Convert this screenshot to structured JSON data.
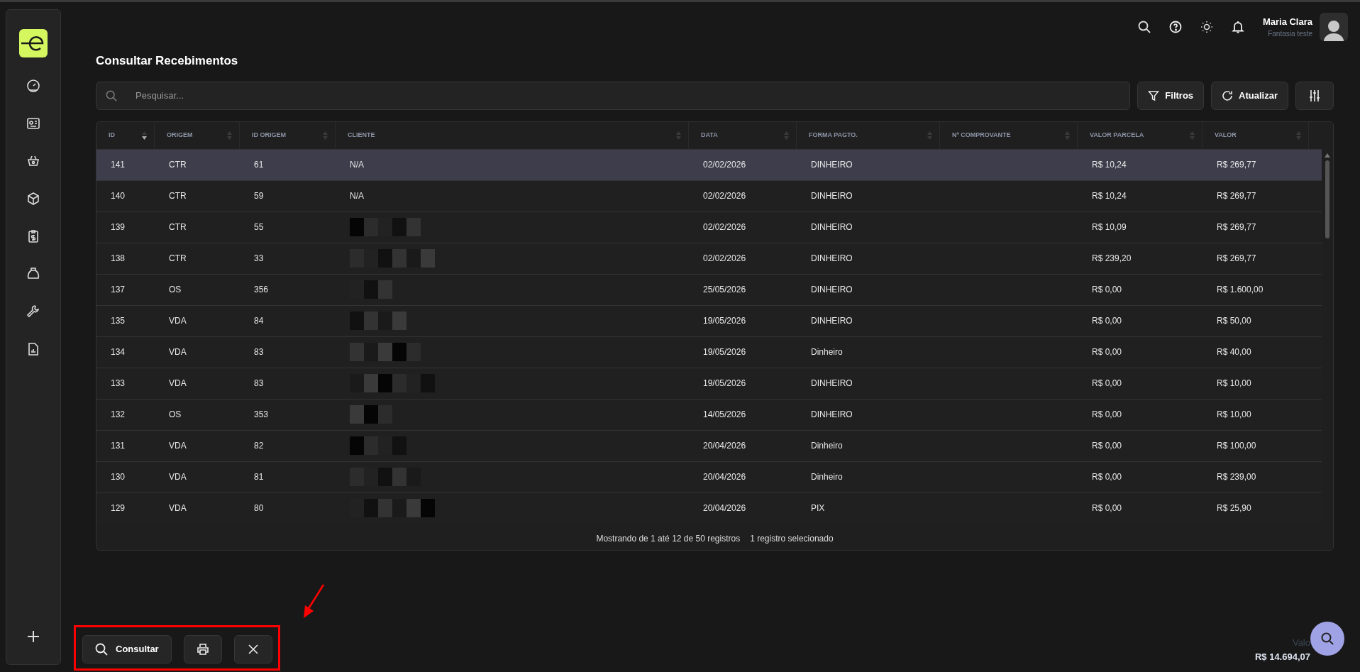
{
  "page_title": "Consultar Recebimentos",
  "user": {
    "name": "Maria Clara",
    "subtitle": "Fantasia teste"
  },
  "search": {
    "placeholder": "Pesquisar..."
  },
  "toolbar": [
    "Filtros",
    "Atualizar"
  ],
  "table": {
    "columns": [
      {
        "label": "ID",
        "sorted_desc": true
      },
      {
        "label": "ORIGEM",
        "sorted_desc": false
      },
      {
        "label": "ID ORIGEM",
        "sorted_desc": false
      },
      {
        "label": "CLIENTE",
        "sorted_desc": false
      },
      {
        "label": "DATA",
        "sorted_desc": false
      },
      {
        "label": "FORMA PAGTO.",
        "sorted_desc": false
      },
      {
        "label": "Nº COMPROVANTE",
        "sorted_desc": false
      },
      {
        "label": "VALOR PARCELA",
        "sorted_desc": false
      },
      {
        "label": "VALOR",
        "sorted_desc": false
      }
    ],
    "rows": [
      {
        "selected": true,
        "id": "141",
        "origem": "CTR",
        "id_origem": "61",
        "cliente": {
          "kind": "text",
          "text": "N/A"
        },
        "data": "02/02/2026",
        "forma": "DINHEIRO",
        "parcela": "R$ 10,24",
        "valor": "R$ 269,77"
      },
      {
        "selected": false,
        "id": "140",
        "origem": "CTR",
        "id_origem": "59",
        "cliente": {
          "kind": "text",
          "text": "N/A"
        },
        "data": "02/02/2026",
        "forma": "DINHEIRO",
        "parcela": "R$ 10,24",
        "valor": "R$ 269,77"
      },
      {
        "selected": false,
        "id": "139",
        "origem": "CTR",
        "id_origem": "55",
        "cliente": {
          "kind": "redacted"
        },
        "data": "02/02/2026",
        "forma": "DINHEIRO",
        "parcela": "R$ 10,09",
        "valor": "R$ 269,77"
      },
      {
        "selected": false,
        "id": "138",
        "origem": "CTR",
        "id_origem": "33",
        "cliente": {
          "kind": "redacted"
        },
        "data": "02/02/2026",
        "forma": "DINHEIRO",
        "parcela": "R$ 239,20",
        "valor": "R$ 269,77"
      },
      {
        "selected": false,
        "id": "137",
        "origem": "OS",
        "id_origem": "356",
        "cliente": {
          "kind": "redacted"
        },
        "data": "25/05/2026",
        "forma": "DINHEIRO",
        "parcela": "R$ 0,00",
        "valor": "R$ 1.600,00"
      },
      {
        "selected": false,
        "id": "135",
        "origem": "VDA",
        "id_origem": "84",
        "cliente": {
          "kind": "redacted"
        },
        "data": "19/05/2026",
        "forma": "DINHEIRO",
        "parcela": "R$ 0,00",
        "valor": "R$ 50,00"
      },
      {
        "selected": false,
        "id": "134",
        "origem": "VDA",
        "id_origem": "83",
        "cliente": {
          "kind": "redacted"
        },
        "data": "19/05/2026",
        "forma": "Dinheiro",
        "parcela": "R$ 0,00",
        "valor": "R$ 40,00"
      },
      {
        "selected": false,
        "id": "133",
        "origem": "VDA",
        "id_origem": "83",
        "cliente": {
          "kind": "redacted"
        },
        "data": "19/05/2026",
        "forma": "DINHEIRO",
        "parcela": "R$ 0,00",
        "valor": "R$ 10,00"
      },
      {
        "selected": false,
        "id": "132",
        "origem": "OS",
        "id_origem": "353",
        "cliente": {
          "kind": "redacted"
        },
        "data": "14/05/2026",
        "forma": "DINHEIRO",
        "parcela": "R$ 0,00",
        "valor": "R$ 10,00"
      },
      {
        "selected": false,
        "id": "131",
        "origem": "VDA",
        "id_origem": "82",
        "cliente": {
          "kind": "redacted"
        },
        "data": "20/04/2026",
        "forma": "Dinheiro",
        "parcela": "R$ 0,00",
        "valor": "R$ 100,00"
      },
      {
        "selected": false,
        "id": "130",
        "origem": "VDA",
        "id_origem": "81",
        "cliente": {
          "kind": "redacted"
        },
        "data": "20/04/2026",
        "forma": "Dinheiro",
        "parcela": "R$ 0,00",
        "valor": "R$ 239,00"
      },
      {
        "selected": false,
        "id": "129",
        "origem": "VDA",
        "id_origem": "80",
        "cliente": {
          "kind": "redacted"
        },
        "data": "20/04/2026",
        "forma": "PIX",
        "parcela": "R$ 0,00",
        "valor": "R$ 25,90"
      }
    ],
    "footer": [
      "Mostrando de 1 até 12 de 50 registros",
      "1 registro selecionado"
    ]
  },
  "actions": {
    "primary": "Consultar"
  },
  "total": {
    "label": "Valo",
    "value": "R$ 14.694,07"
  }
}
